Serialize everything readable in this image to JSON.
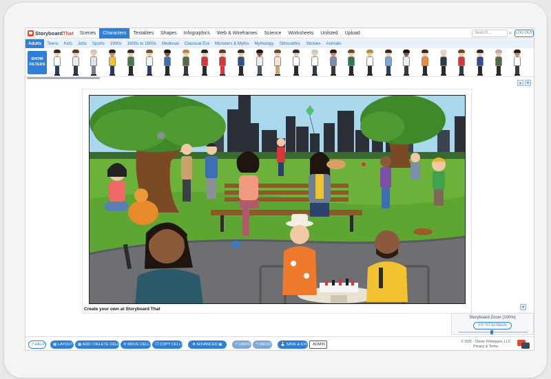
{
  "app": {
    "logo_storyboard": "Storyboard",
    "logo_that": "That"
  },
  "topnav": {
    "items": [
      "Scenes",
      "Characters",
      "Textables",
      "Shapes",
      "Infographics",
      "Web & Wireframes",
      "Science",
      "Worksheets",
      "Unlisted",
      "Upload"
    ],
    "active_index": 1,
    "search_placeholder": "Search...",
    "logout_label": "LOG OUT"
  },
  "subnav": {
    "items": [
      "Adults",
      "Teens",
      "Kids",
      "Jobs",
      "Sports",
      "1900s",
      "1600s to 1800s",
      "Medieval",
      "Classical Era",
      "Monsters & Myths",
      "Mythology",
      "Silhouettes",
      "Stickies",
      "Animals"
    ],
    "active_index": 0
  },
  "strip": {
    "filters_line1": "SHOW",
    "filters_line2": "FILTERS",
    "characters": [
      {
        "skin": "#f2c9a5",
        "hair": "#3a2a1f",
        "top": "#ffffff",
        "legs": "#2c3e66"
      },
      {
        "skin": "#f2c9a5",
        "hair": "#5b3a22",
        "top": "#e9eef5",
        "legs": "#2f3a4f"
      },
      {
        "skin": "#f2c9a5",
        "hair": "#c9c9c9",
        "top": "#dfe3e8",
        "legs": "#7a7f86"
      },
      {
        "skin": "#c58c5f",
        "hair": "#2b1d12",
        "top": "#f2c230",
        "legs": "#263a6b"
      },
      {
        "skin": "#f2c9a5",
        "hair": "#3a2a1f",
        "top": "#4a7a4a",
        "legs": "#2b2b2b"
      },
      {
        "skin": "#f2c9a5",
        "hair": "#7a5232",
        "top": "#f4f4f4",
        "legs": "#2d4170"
      },
      {
        "skin": "#8a5a3a",
        "hair": "#1e150f",
        "top": "#3d6fb3",
        "legs": "#2b2b2b"
      },
      {
        "skin": "#f2c9a5",
        "hair": "#b58a4f",
        "top": "#556b44",
        "legs": "#3a3a3a"
      },
      {
        "skin": "#f2c9a5",
        "hair": "#222222",
        "top": "#d8383b",
        "legs": "#2b2b2b"
      },
      {
        "skin": "#f2c9a5",
        "hair": "#5a3b24",
        "top": "#d8383b",
        "legs": "#d8383b"
      },
      {
        "skin": "#f2c9a5",
        "hair": "#3a2a1f",
        "top": "#2f4f8f",
        "legs": "#2b2b2b"
      },
      {
        "skin": "#8a5a3a",
        "hair": "#1e150f",
        "top": "#ececec",
        "legs": "#4c5a6d"
      },
      {
        "skin": "#f2c9a5",
        "hair": "#6e4a2c",
        "top": "#f1e6d6",
        "legs": "#c9a778"
      },
      {
        "skin": "#f2c9a5",
        "hair": "#2b2b2b",
        "top": "#ffffff",
        "legs": "#2b2b2b"
      },
      {
        "skin": "#f2c9a5",
        "hair": "#c9c9c9",
        "top": "#ffffff",
        "legs": "#2f3a4f"
      },
      {
        "skin": "#c58c5f",
        "hair": "#2b1d12",
        "top": "#7b8fa6",
        "legs": "#3a3a3a"
      },
      {
        "skin": "#f2c9a5",
        "hair": "#6e4a2c",
        "top": "#2d7a4f",
        "legs": "#2b2b2b"
      },
      {
        "skin": "#f2c9a5",
        "hair": "#b58a4f",
        "top": "#ffffff",
        "legs": "#2b2b2b"
      },
      {
        "skin": "#f2c9a5",
        "hair": "#3a2a1f",
        "top": "#7aa6d6",
        "legs": "#2d4170"
      },
      {
        "skin": "#8a5a3a",
        "hair": "#1e150f",
        "top": "#f0f0f0",
        "legs": "#3a3a3a"
      },
      {
        "skin": "#f2c9a5",
        "hair": "#3a2a1f",
        "top": "#ef8b3a",
        "legs": "#2b2b2b"
      },
      {
        "skin": "#f2c9a5",
        "hair": "#d9d9d9",
        "top": "#2f3a4f",
        "legs": "#2b2b2b"
      },
      {
        "skin": "#f2c9a5",
        "hair": "#6e4a2c",
        "top": "#d8383b",
        "legs": "#2f3a4f"
      },
      {
        "skin": "#f2c9a5",
        "hair": "#2b2b2b",
        "top": "#2f4f8f",
        "legs": "#2b2b2b"
      },
      {
        "skin": "#f2c9a5",
        "hair": "#b0b0b0",
        "top": "#556b44",
        "legs": "#2b2b2b"
      },
      {
        "skin": "#c58c5f",
        "hair": "#2b1d12",
        "top": "#ffffff",
        "legs": "#3a3a3a"
      }
    ]
  },
  "canvas": {
    "caption": "Create your own at Storyboard That"
  },
  "zoom": {
    "title": "Storyboard Zoom (100%)",
    "fit_label": "FIT TO SCREEN"
  },
  "toolbar": {
    "help": "? HELP",
    "layout": "LAYOUT",
    "add_delete": "ADD / DELETE CELLS",
    "move": "MOVE CELLS",
    "copy": "COPY CELLS",
    "advanced": "ADVANCED",
    "undo": "UNDO",
    "redo": "REDO",
    "save": "SAVE & EXIT",
    "admin": "ADMIN",
    "copyright_line1": "© 2021 · Clever Prototypes, LLC",
    "copyright_line2": "Privacy & Terms"
  },
  "colors": {
    "accent": "#2f7fd8",
    "brand": "#e7492d"
  }
}
